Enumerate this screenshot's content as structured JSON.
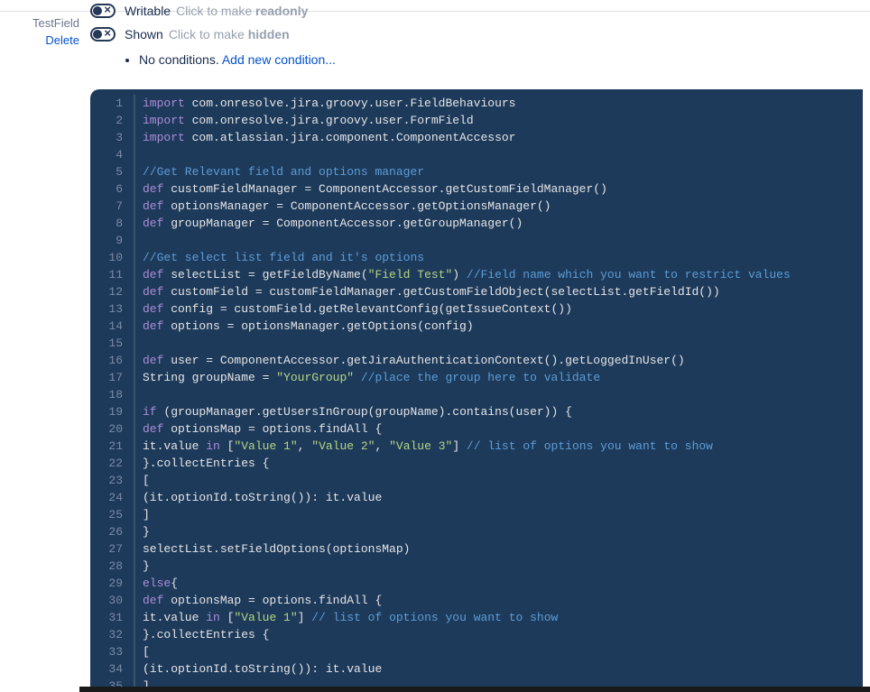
{
  "side": {
    "field_label": "TestField",
    "delete_label": "Delete"
  },
  "option_rows": [
    {
      "name": "writable-row",
      "title": "Writable",
      "hint_prefix": "Click to make ",
      "hint_bold": "readonly"
    },
    {
      "name": "shown-row",
      "title": "Shown",
      "hint_prefix": "Click to make ",
      "hint_bold": "hidden"
    }
  ],
  "conditions": {
    "text": "No conditions.",
    "link": "Add new condition..."
  },
  "colors": {
    "editor_bg": "#1d3a5b",
    "keyword": "#ad8cd6",
    "string": "#b5d682",
    "comment": "#5d9cd4",
    "text": "#e5e5e5",
    "link": "#0052cc"
  },
  "code_lines": [
    [
      {
        "c": "kw",
        "t": "import"
      },
      {
        "c": "plain",
        "t": " com.onresolve.jira.groovy.user.FieldBehaviours"
      }
    ],
    [
      {
        "c": "kw",
        "t": "import"
      },
      {
        "c": "plain",
        "t": " com.onresolve.jira.groovy.user.FormField"
      }
    ],
    [
      {
        "c": "kw",
        "t": "import"
      },
      {
        "c": "plain",
        "t": " com.atlassian.jira.component.ComponentAccessor"
      }
    ],
    [],
    [
      {
        "c": "cmt",
        "t": "//Get Relevant field and options manager"
      }
    ],
    [
      {
        "c": "kw",
        "t": "def"
      },
      {
        "c": "plain",
        "t": " customFieldManager = ComponentAccessor.getCustomFieldManager()"
      }
    ],
    [
      {
        "c": "kw",
        "t": "def"
      },
      {
        "c": "plain",
        "t": " optionsManager = ComponentAccessor.getOptionsManager()"
      }
    ],
    [
      {
        "c": "kw",
        "t": "def"
      },
      {
        "c": "plain",
        "t": " groupManager = ComponentAccessor.getGroupManager()"
      }
    ],
    [],
    [
      {
        "c": "cmt",
        "t": "//Get select list field and it's options"
      }
    ],
    [
      {
        "c": "kw",
        "t": "def"
      },
      {
        "c": "plain",
        "t": " selectList = getFieldByName("
      },
      {
        "c": "str",
        "t": "\"Field Test\""
      },
      {
        "c": "plain",
        "t": ") "
      },
      {
        "c": "cmt",
        "t": "//Field name which you want to restrict values"
      }
    ],
    [
      {
        "c": "kw",
        "t": "def"
      },
      {
        "c": "plain",
        "t": " customField = customFieldManager.getCustomFieldObject(selectList.getFieldId())"
      }
    ],
    [
      {
        "c": "kw",
        "t": "def"
      },
      {
        "c": "plain",
        "t": " config = customField.getRelevantConfig(getIssueContext())"
      }
    ],
    [
      {
        "c": "kw",
        "t": "def"
      },
      {
        "c": "plain",
        "t": " options = optionsManager.getOptions(config)"
      }
    ],
    [],
    [
      {
        "c": "kw",
        "t": "def"
      },
      {
        "c": "plain",
        "t": " user = ComponentAccessor.getJiraAuthenticationContext().getLoggedInUser()"
      }
    ],
    [
      {
        "c": "plain",
        "t": "String groupName = "
      },
      {
        "c": "str",
        "t": "\"YourGroup\""
      },
      {
        "c": "plain",
        "t": " "
      },
      {
        "c": "cmt",
        "t": "//place the group here to validate"
      }
    ],
    [],
    [
      {
        "c": "kw",
        "t": "if"
      },
      {
        "c": "plain",
        "t": " (groupManager.getUsersInGroup(groupName).contains(user)) {"
      }
    ],
    [
      {
        "c": "kw",
        "t": "def"
      },
      {
        "c": "plain",
        "t": " optionsMap = options.findAll {"
      }
    ],
    [
      {
        "c": "plain",
        "t": "it.value "
      },
      {
        "c": "kw",
        "t": "in"
      },
      {
        "c": "plain",
        "t": " ["
      },
      {
        "c": "str",
        "t": "\"Value 1\""
      },
      {
        "c": "plain",
        "t": ", "
      },
      {
        "c": "str",
        "t": "\"Value 2\""
      },
      {
        "c": "plain",
        "t": ", "
      },
      {
        "c": "str",
        "t": "\"Value 3\""
      },
      {
        "c": "plain",
        "t": "] "
      },
      {
        "c": "cmt",
        "t": "// list of options you want to show"
      }
    ],
    [
      {
        "c": "plain",
        "t": "}.collectEntries {"
      }
    ],
    [
      {
        "c": "plain",
        "t": "["
      }
    ],
    [
      {
        "c": "plain",
        "t": "(it.optionId.toString()): it.value"
      }
    ],
    [
      {
        "c": "plain",
        "t": "]"
      }
    ],
    [
      {
        "c": "plain",
        "t": "}"
      }
    ],
    [
      {
        "c": "plain",
        "t": "selectList.setFieldOptions(optionsMap)"
      }
    ],
    [
      {
        "c": "plain",
        "t": "}"
      }
    ],
    [
      {
        "c": "kw",
        "t": "else"
      },
      {
        "c": "plain",
        "t": "{"
      }
    ],
    [
      {
        "c": "kw",
        "t": "def"
      },
      {
        "c": "plain",
        "t": " optionsMap = options.findAll {"
      }
    ],
    [
      {
        "c": "plain",
        "t": "it.value "
      },
      {
        "c": "kw",
        "t": "in"
      },
      {
        "c": "plain",
        "t": " ["
      },
      {
        "c": "str",
        "t": "\"Value 1\""
      },
      {
        "c": "plain",
        "t": "] "
      },
      {
        "c": "cmt",
        "t": "// list of options you want to show"
      }
    ],
    [
      {
        "c": "plain",
        "t": "}.collectEntries {"
      }
    ],
    [
      {
        "c": "plain",
        "t": "["
      }
    ],
    [
      {
        "c": "plain",
        "t": "(it.optionId.toString()): it.value"
      }
    ],
    [
      {
        "c": "plain",
        "t": "]"
      }
    ]
  ]
}
